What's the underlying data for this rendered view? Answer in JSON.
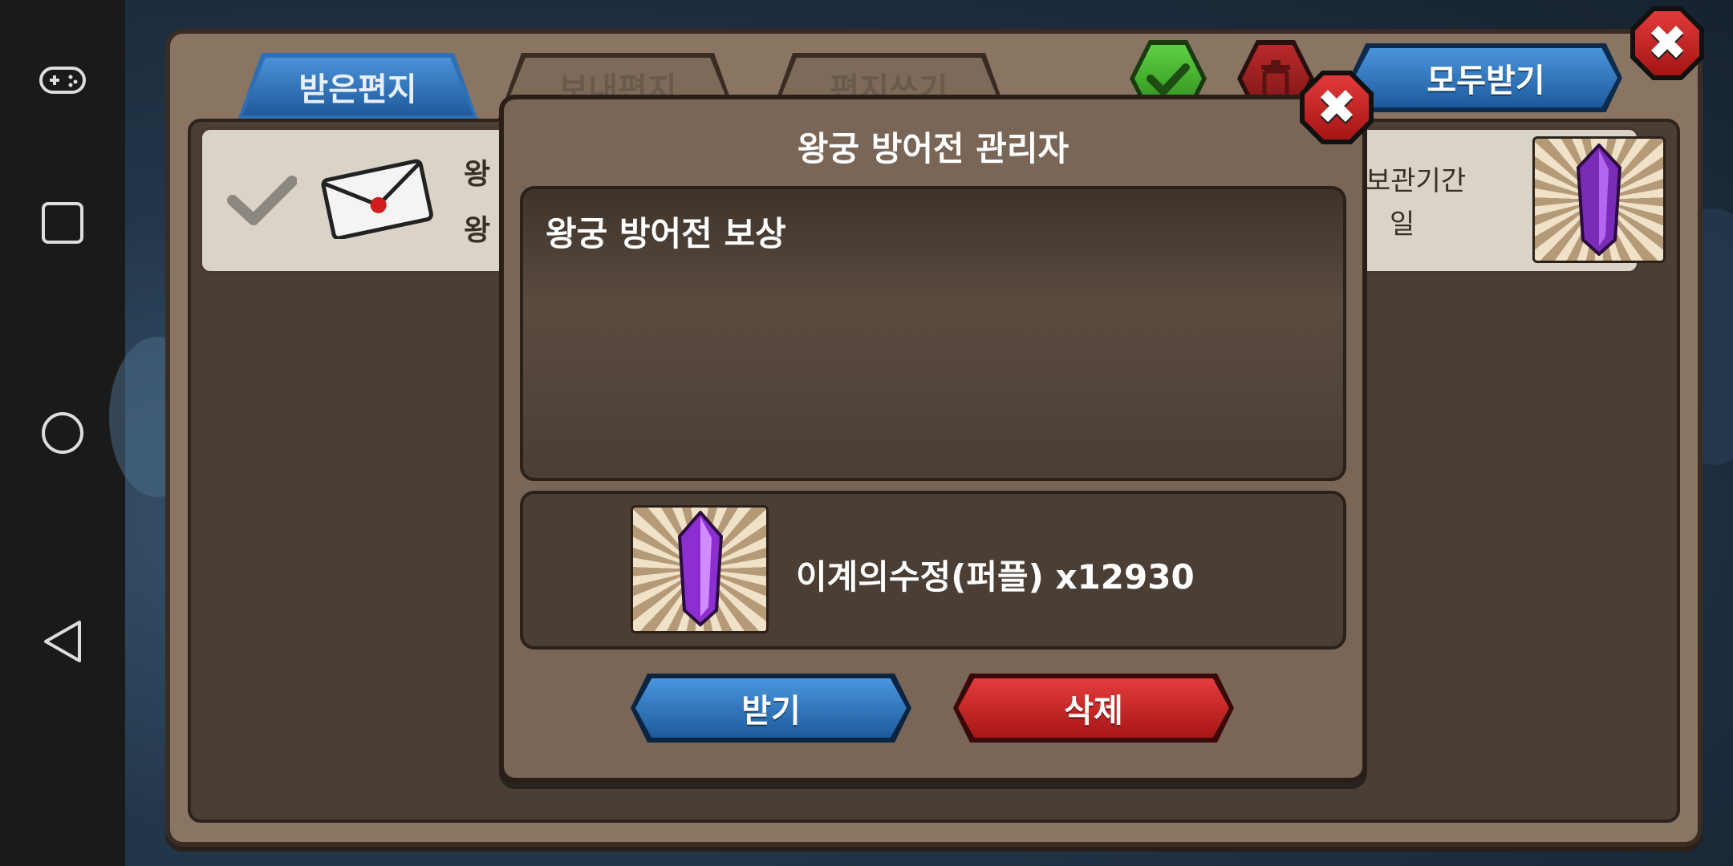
{
  "tabs": [
    {
      "label": "받은편지",
      "active": true
    },
    {
      "label": "보내편지",
      "active": false
    },
    {
      "label": "편지쓰기",
      "active": false
    }
  ],
  "toolbar": {
    "receive_all_label": "모두받기"
  },
  "mail_row": {
    "sender_partial_1": "왕",
    "sender_partial_2": "왕",
    "storage_partial": "보관기간",
    "days_partial": "일"
  },
  "modal": {
    "title": "왕궁 방어전 관리자",
    "message": "왕궁 방어전 보상",
    "reward_label": "이계의수정(퍼플) x12930",
    "receive_button": "받기",
    "delete_button": "삭제"
  },
  "colors": {
    "primary_blue": "#2f6fb5",
    "danger_red": "#c42222",
    "confirm_green": "#3fae2a",
    "panel_brown": "#7a6656"
  },
  "icons": [
    "gamepad-icon",
    "square-icon",
    "circle-icon",
    "back-triangle-icon",
    "check-icon",
    "trash-icon",
    "close-icon",
    "envelope-icon",
    "purple-crystal-icon"
  ]
}
